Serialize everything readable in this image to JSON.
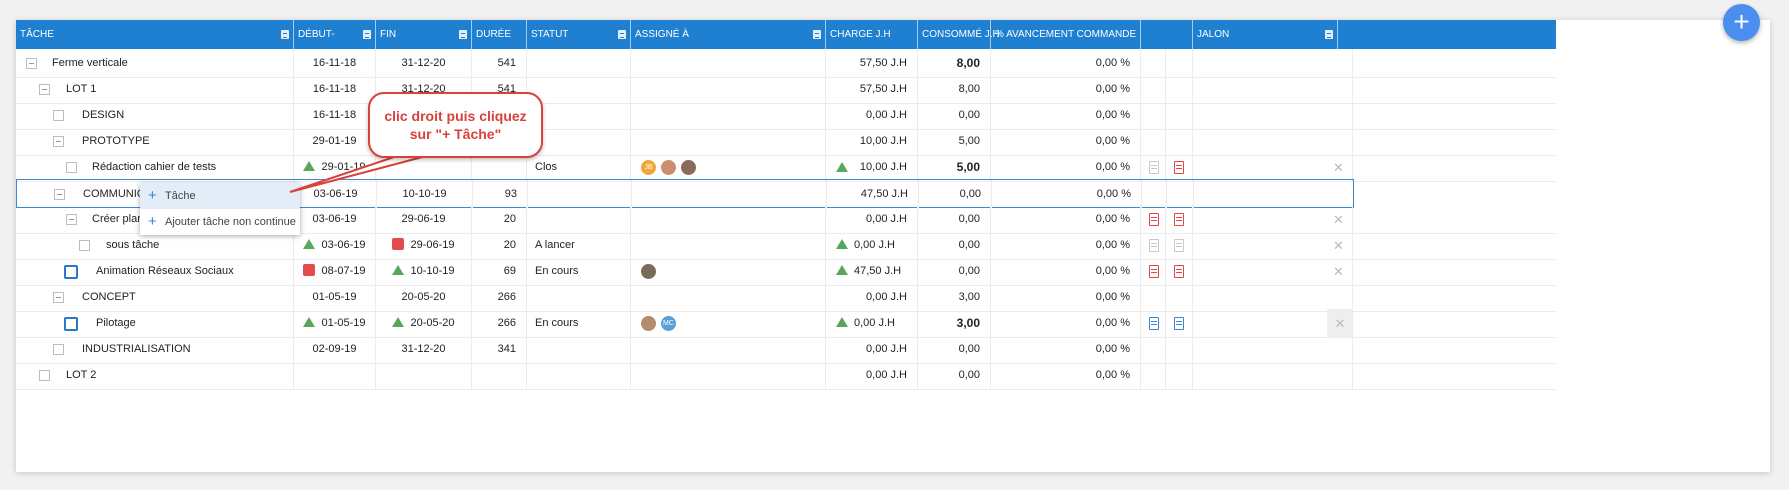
{
  "header": {
    "tache": "TÂCHE",
    "debut": "DÉBUT-",
    "fin": "FIN",
    "duree": "DURÉE",
    "statut": "STATUT",
    "assigne": "ASSIGNÉ À",
    "charge": "CHARGE J.H",
    "consomme": "CONSOMMÉ J.H",
    "avancement": "% AVANCEMENT COMMANDE",
    "jalon": "JALON"
  },
  "fab_label": "+",
  "rows": [
    {
      "name": "Ferme verticale",
      "debut": "16-11-18",
      "fin": "31-12-20",
      "duree": "541",
      "statut": "",
      "charge": "57,50 J.H",
      "consomme": "8,00",
      "avancement": "0,00 %"
    },
    {
      "name": "LOT 1",
      "debut": "16-11-18",
      "fin": "31-12-20",
      "duree": "541",
      "statut": "",
      "charge": "57,50 J.H",
      "consomme": "8,00",
      "avancement": "0,00 %"
    },
    {
      "name": "DESIGN",
      "debut": "16-11-18",
      "fin": "",
      "duree": "",
      "statut": "",
      "charge": "0,00 J.H",
      "consomme": "0,00",
      "avancement": "0,00 %"
    },
    {
      "name": "PROTOTYPE",
      "debut": "29-01-19",
      "fin": "",
      "duree": "",
      "statut": "",
      "charge": "10,00 J.H",
      "consomme": "5,00",
      "avancement": "0,00 %"
    },
    {
      "name": "Rédaction cahier de tests",
      "debut": "29-01-19",
      "fin": "",
      "duree": "",
      "statut": "Clos",
      "charge": "10,00 J.H",
      "consomme": "5,00",
      "avancement": "0,00 %"
    },
    {
      "name": "COMMUNICA",
      "debut": "03-06-19",
      "fin": "10-10-19",
      "duree": "93",
      "statut": "",
      "charge": "47,50 J.H",
      "consomme": "0,00",
      "avancement": "0,00 %"
    },
    {
      "name": "Créer plan d",
      "debut": "03-06-19",
      "fin": "29-06-19",
      "duree": "20",
      "statut": "",
      "charge": "0,00 J.H",
      "consomme": "0,00",
      "avancement": "0,00 %"
    },
    {
      "name": "sous tâche",
      "debut": "03-06-19",
      "fin": "29-06-19",
      "duree": "20",
      "statut": "A lancer",
      "charge": "0,00 J.H",
      "consomme": "0,00",
      "avancement": "0,00 %"
    },
    {
      "name": "Animation Réseaux Sociaux",
      "debut": "08-07-19",
      "fin": "10-10-19",
      "duree": "69",
      "statut": "En cours",
      "charge": "47,50 J.H",
      "consomme": "0,00",
      "avancement": "0,00 %"
    },
    {
      "name": "CONCEPT",
      "debut": "01-05-19",
      "fin": "20-05-20",
      "duree": "266",
      "statut": "",
      "charge": "0,00 J.H",
      "consomme": "3,00",
      "avancement": "0,00 %"
    },
    {
      "name": "Pilotage",
      "debut": "01-05-19",
      "fin": "20-05-20",
      "duree": "266",
      "statut": "En cours",
      "charge": "0,00 J.H",
      "consomme": "3,00",
      "avancement": "0,00 %"
    },
    {
      "name": "INDUSTRIALISATION",
      "debut": "02-09-19",
      "fin": "31-12-20",
      "duree": "341",
      "statut": "",
      "charge": "0,00 J.H",
      "consomme": "0,00",
      "avancement": "0,00 %"
    },
    {
      "name": "LOT 2",
      "debut": "",
      "fin": "",
      "duree": "",
      "statut": "",
      "charge": "0,00 J.H",
      "consomme": "0,00",
      "avancement": "0,00 %"
    }
  ],
  "avatars": {
    "row4_1": "JB",
    "row10_2": "MC"
  },
  "context_menu": {
    "item1": "Tâche",
    "item2": "Ajouter tâche non continue"
  },
  "callout": {
    "line1": "clic droit puis cliquez",
    "line2": "sur \"+ Tâche\""
  },
  "colors": {
    "header_bg": "#1f7fd0",
    "status_up": "#5aa65d",
    "status_late": "#e44a4a",
    "callout": "#d9413a"
  }
}
